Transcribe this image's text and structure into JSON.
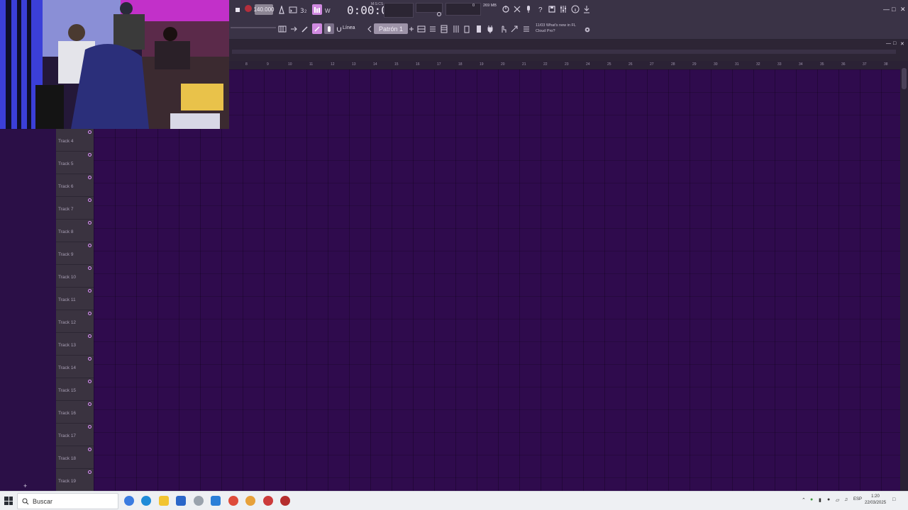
{
  "toolbar": {
    "tempo": "140.000",
    "time": "0:00:00",
    "time_unit": "M:S:CS",
    "memory": "269 MB",
    "cpu": "0",
    "snap": "Línea",
    "pattern": "Patrón 1",
    "news_line1": "11/03  What's new in FL",
    "news_line2": "Cloud Pro?"
  },
  "ruler": [
    "8",
    "9",
    "10",
    "11",
    "12",
    "13",
    "14",
    "15",
    "16",
    "17",
    "18",
    "19",
    "20",
    "21",
    "22",
    "23",
    "24",
    "25",
    "26",
    "27",
    "28",
    "29",
    "30",
    "31",
    "32",
    "33",
    "34",
    "35",
    "36",
    "37",
    "38"
  ],
  "tracks": [
    "Track 4",
    "Track 5",
    "Track 6",
    "Track 7",
    "Track 8",
    "Track 9",
    "Track 10",
    "Track 11",
    "Track 12",
    "Track 13",
    "Track 14",
    "Track 15",
    "Track 16",
    "Track 17",
    "Track 18",
    "Track 19"
  ],
  "taskbar": {
    "search_placeholder": "Buscar",
    "lang": "ESP",
    "time": "1:20",
    "date": "22/03/2025"
  },
  "colors": {
    "grid_bg": "#2f0b4d",
    "toolbar_bg": "#3a3346",
    "accent_pink": "#d08ae0",
    "record_red": "#b52e3c"
  }
}
